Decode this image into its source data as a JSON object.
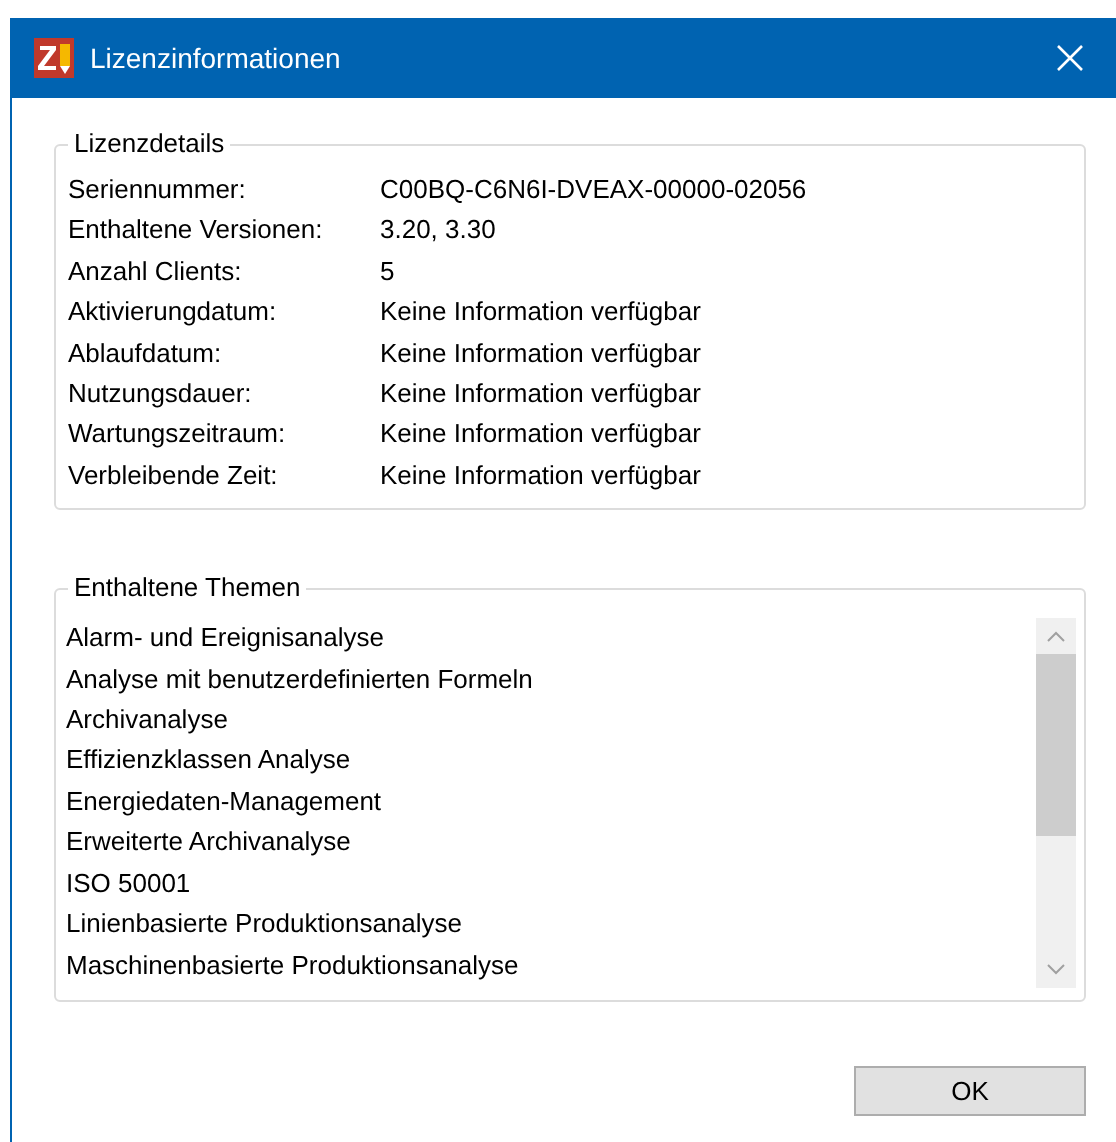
{
  "window": {
    "title": "Lizenzinformationen"
  },
  "license_details": {
    "title": "Lizenzdetails",
    "rows": [
      {
        "label": "Seriennummer:",
        "value": "C00BQ-C6N6I-DVEAX-00000-02056"
      },
      {
        "label": "Enthaltene Versionen:",
        "value": "3.20, 3.30"
      },
      {
        "label": "Anzahl Clients:",
        "value": "5"
      },
      {
        "label": "Aktivierungdatum:",
        "value": "Keine Information verfügbar"
      },
      {
        "label": "Ablaufdatum:",
        "value": "Keine Information verfügbar"
      },
      {
        "label": "Nutzungsdauer:",
        "value": "Keine Information verfügbar"
      },
      {
        "label": "Wartungszeitraum:",
        "value": "Keine Information verfügbar"
      },
      {
        "label": "Verbleibende Zeit:",
        "value": "Keine Information verfügbar"
      }
    ]
  },
  "topics": {
    "title": "Enthaltene Themen",
    "items": [
      "Alarm- und Ereignisanalyse",
      "Analyse mit benutzerdefinierten Formeln",
      "Archivanalyse",
      "Effizienzklassen Analyse",
      "Energiedaten-Management",
      "Erweiterte Archivanalyse",
      "ISO 50001",
      "Linienbasierte Produktionsanalyse",
      "Maschinenbasierte Produktionsanalyse"
    ]
  },
  "buttons": [
    "OK"
  ]
}
